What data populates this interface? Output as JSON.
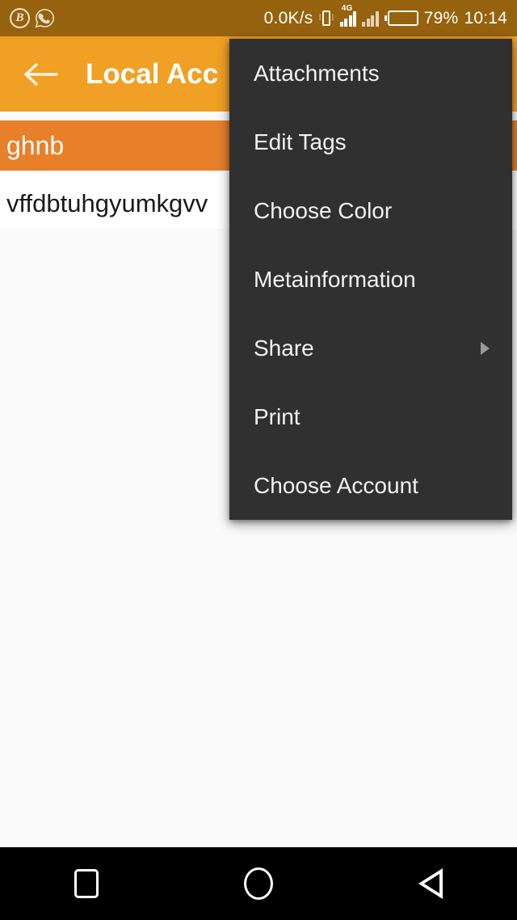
{
  "status_bar": {
    "background_color": "#96620D",
    "left_icons": [
      {
        "name": "browser-b-icon",
        "glyph": "B"
      },
      {
        "name": "whatsapp-icon",
        "glyph": "whatsapp"
      }
    ],
    "network_speed": "0.0K/s",
    "vibrate_icon": "vibrate",
    "network_type": "4G",
    "battery_percent": "79%",
    "battery_level": 79,
    "time": "10:14"
  },
  "app_bar": {
    "background_color": "#F0A024",
    "back_icon": "arrow-left-icon",
    "title": "Local Acc"
  },
  "content": {
    "note_title": "ghnb",
    "note_title_band_color": "#E8802A",
    "note_body_value": "vffdbtuhgyumkgvv",
    "underline_color": "#E8802A",
    "background_color": "#FAFAFA"
  },
  "overflow_menu": {
    "background_color": "#303030",
    "text_color": "#F2F2F2",
    "items": [
      {
        "label": "Attachments",
        "has_submenu": false
      },
      {
        "label": "Edit Tags",
        "has_submenu": false
      },
      {
        "label": "Choose Color",
        "has_submenu": false
      },
      {
        "label": "Metainformation",
        "has_submenu": false
      },
      {
        "label": "Share",
        "has_submenu": true
      },
      {
        "label": "Print",
        "has_submenu": false
      },
      {
        "label": "Choose Account",
        "has_submenu": false
      }
    ]
  },
  "nav_bar": {
    "background_color": "#000000",
    "buttons": [
      {
        "name": "recents-button",
        "icon": "square-icon"
      },
      {
        "name": "home-button",
        "icon": "circle-icon"
      },
      {
        "name": "back-button",
        "icon": "triangle-left-icon"
      }
    ]
  }
}
